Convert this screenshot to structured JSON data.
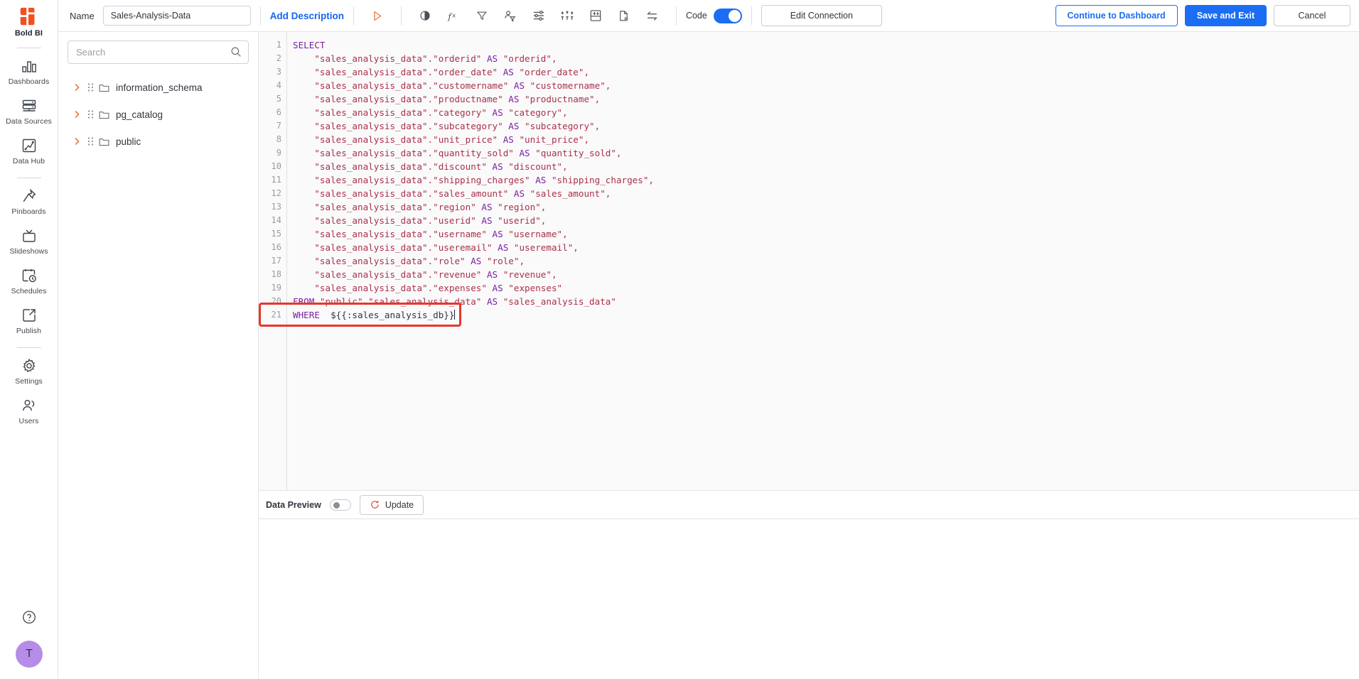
{
  "rail": {
    "brand_name": "Bold BI",
    "items": [
      {
        "label": "Dashboards",
        "icon": "bar-chart-icon"
      },
      {
        "label": "Data Sources",
        "icon": "database-icon"
      },
      {
        "label": "Data Hub",
        "icon": "data-hub-icon"
      },
      {
        "label": "Pinboards",
        "icon": "pin-icon"
      },
      {
        "label": "Slideshows",
        "icon": "slideshow-icon"
      },
      {
        "label": "Schedules",
        "icon": "schedule-clock-icon"
      },
      {
        "label": "Publish",
        "icon": "publish-export-icon"
      },
      {
        "label": "Settings",
        "icon": "gear-icon"
      },
      {
        "label": "Users",
        "icon": "users-icon"
      }
    ],
    "help_icon": "help-circle-icon",
    "avatar_initial": "T"
  },
  "toolbar": {
    "name_label": "Name",
    "name_value": "Sales-Analysis-Data",
    "name_placeholder": "Name",
    "add_description": "Add Description",
    "icons": [
      {
        "name": "run-query-icon",
        "title": "Run"
      },
      {
        "name": "contrast-theme-icon",
        "title": "Theme"
      },
      {
        "name": "expression-fx-icon",
        "title": "Expression"
      },
      {
        "name": "filter-icon",
        "title": "Filter"
      },
      {
        "name": "user-filter-icon",
        "title": "User Filter"
      },
      {
        "name": "settings-sliders-icon",
        "title": "Settings"
      },
      {
        "name": "column-settings-icon",
        "title": "Columns"
      },
      {
        "name": "table-settings-icon",
        "title": "Table"
      },
      {
        "name": "file-status-icon",
        "title": "File"
      },
      {
        "name": "transform-swap-icon",
        "title": "Transform"
      }
    ],
    "code_label": "Code",
    "code_enabled": true,
    "edit_connection": "Edit Connection",
    "continue_to_dashboard": "Continue to Dashboard",
    "save_and_exit": "Save and Exit",
    "cancel": "Cancel",
    "accent_blue": "#1b6ef3",
    "accent_orange": "#f3501e"
  },
  "tree": {
    "search_placeholder": "Search",
    "search_value": "",
    "nodes": [
      {
        "label": "information_schema",
        "expanded": false
      },
      {
        "label": "pg_catalog",
        "expanded": false
      },
      {
        "label": "public",
        "expanded": false
      }
    ]
  },
  "editor": {
    "line_numbers": [
      1,
      2,
      3,
      4,
      5,
      6,
      7,
      8,
      9,
      10,
      11,
      12,
      13,
      14,
      15,
      16,
      17,
      18,
      19,
      20,
      21
    ],
    "lines": [
      {
        "n": 1,
        "tokens": [
          {
            "t": "SELECT",
            "c": "kw"
          }
        ]
      },
      {
        "n": 2,
        "tokens": [
          {
            "t": "    \"sales_analysis_data\".\"orderid\" ",
            "c": "id"
          },
          {
            "t": "AS ",
            "c": "kw"
          },
          {
            "t": "\"orderid\",",
            "c": "id"
          }
        ]
      },
      {
        "n": 3,
        "tokens": [
          {
            "t": "    \"sales_analysis_data\".\"order_date\" ",
            "c": "id"
          },
          {
            "t": "AS ",
            "c": "kw"
          },
          {
            "t": "\"order_date\",",
            "c": "id"
          }
        ]
      },
      {
        "n": 4,
        "tokens": [
          {
            "t": "    \"sales_analysis_data\".\"customername\" ",
            "c": "id"
          },
          {
            "t": "AS ",
            "c": "kw"
          },
          {
            "t": "\"customername\",",
            "c": "id"
          }
        ]
      },
      {
        "n": 5,
        "tokens": [
          {
            "t": "    \"sales_analysis_data\".\"productname\" ",
            "c": "id"
          },
          {
            "t": "AS ",
            "c": "kw"
          },
          {
            "t": "\"productname\",",
            "c": "id"
          }
        ]
      },
      {
        "n": 6,
        "tokens": [
          {
            "t": "    \"sales_analysis_data\".\"category\" ",
            "c": "id"
          },
          {
            "t": "AS ",
            "c": "kw"
          },
          {
            "t": "\"category\",",
            "c": "id"
          }
        ]
      },
      {
        "n": 7,
        "tokens": [
          {
            "t": "    \"sales_analysis_data\".\"subcategory\" ",
            "c": "id"
          },
          {
            "t": "AS ",
            "c": "kw"
          },
          {
            "t": "\"subcategory\",",
            "c": "id"
          }
        ]
      },
      {
        "n": 8,
        "tokens": [
          {
            "t": "    \"sales_analysis_data\".\"unit_price\" ",
            "c": "id"
          },
          {
            "t": "AS ",
            "c": "kw"
          },
          {
            "t": "\"unit_price\",",
            "c": "id"
          }
        ]
      },
      {
        "n": 9,
        "tokens": [
          {
            "t": "    \"sales_analysis_data\".\"quantity_sold\" ",
            "c": "id"
          },
          {
            "t": "AS ",
            "c": "kw"
          },
          {
            "t": "\"quantity_sold\",",
            "c": "id"
          }
        ]
      },
      {
        "n": 10,
        "tokens": [
          {
            "t": "    \"sales_analysis_data\".\"discount\" ",
            "c": "id"
          },
          {
            "t": "AS ",
            "c": "kw"
          },
          {
            "t": "\"discount\",",
            "c": "id"
          }
        ]
      },
      {
        "n": 11,
        "tokens": [
          {
            "t": "    \"sales_analysis_data\".\"shipping_charges\" ",
            "c": "id"
          },
          {
            "t": "AS ",
            "c": "kw"
          },
          {
            "t": "\"shipping_charges\",",
            "c": "id"
          }
        ]
      },
      {
        "n": 12,
        "tokens": [
          {
            "t": "    \"sales_analysis_data\".\"sales_amount\" ",
            "c": "id"
          },
          {
            "t": "AS ",
            "c": "kw"
          },
          {
            "t": "\"sales_amount\",",
            "c": "id"
          }
        ]
      },
      {
        "n": 13,
        "tokens": [
          {
            "t": "    \"sales_analysis_data\".\"region\" ",
            "c": "id"
          },
          {
            "t": "AS ",
            "c": "kw"
          },
          {
            "t": "\"region\",",
            "c": "id"
          }
        ]
      },
      {
        "n": 14,
        "tokens": [
          {
            "t": "    \"sales_analysis_data\".\"userid\" ",
            "c": "id"
          },
          {
            "t": "AS ",
            "c": "kw"
          },
          {
            "t": "\"userid\",",
            "c": "id"
          }
        ]
      },
      {
        "n": 15,
        "tokens": [
          {
            "t": "    \"sales_analysis_data\".\"username\" ",
            "c": "id"
          },
          {
            "t": "AS ",
            "c": "kw"
          },
          {
            "t": "\"username\",",
            "c": "id"
          }
        ]
      },
      {
        "n": 16,
        "tokens": [
          {
            "t": "    \"sales_analysis_data\".\"useremail\" ",
            "c": "id"
          },
          {
            "t": "AS ",
            "c": "kw"
          },
          {
            "t": "\"useremail\",",
            "c": "id"
          }
        ]
      },
      {
        "n": 17,
        "tokens": [
          {
            "t": "    \"sales_analysis_data\".\"role\" ",
            "c": "id"
          },
          {
            "t": "AS ",
            "c": "kw"
          },
          {
            "t": "\"role\",",
            "c": "id"
          }
        ]
      },
      {
        "n": 18,
        "tokens": [
          {
            "t": "    \"sales_analysis_data\".\"revenue\" ",
            "c": "id"
          },
          {
            "t": "AS ",
            "c": "kw"
          },
          {
            "t": "\"revenue\",",
            "c": "id"
          }
        ]
      },
      {
        "n": 19,
        "tokens": [
          {
            "t": "    \"sales_analysis_data\".\"expenses\" ",
            "c": "id"
          },
          {
            "t": "AS ",
            "c": "kw"
          },
          {
            "t": "\"expenses\"",
            "c": "id"
          }
        ]
      },
      {
        "n": 20,
        "tokens": [
          {
            "t": "FROM ",
            "c": "kw"
          },
          {
            "t": "\"public\".\"sales_analysis_data\" ",
            "c": "id"
          },
          {
            "t": "AS ",
            "c": "kw"
          },
          {
            "t": "\"sales_analysis_data\"",
            "c": "id"
          }
        ]
      },
      {
        "n": 21,
        "tokens": [
          {
            "t": "WHERE ",
            "c": "kw"
          },
          {
            "t": " ${{:sales_analysis_db}}",
            "c": "var"
          }
        ]
      }
    ],
    "highlight": {
      "line": 21,
      "text": "WHERE  ${{:sales_analysis_db}}",
      "color": "#e8362a"
    }
  },
  "preview": {
    "label": "Data Preview",
    "enabled": false,
    "update_label": "Update",
    "refresh_icon": "refresh-icon"
  }
}
